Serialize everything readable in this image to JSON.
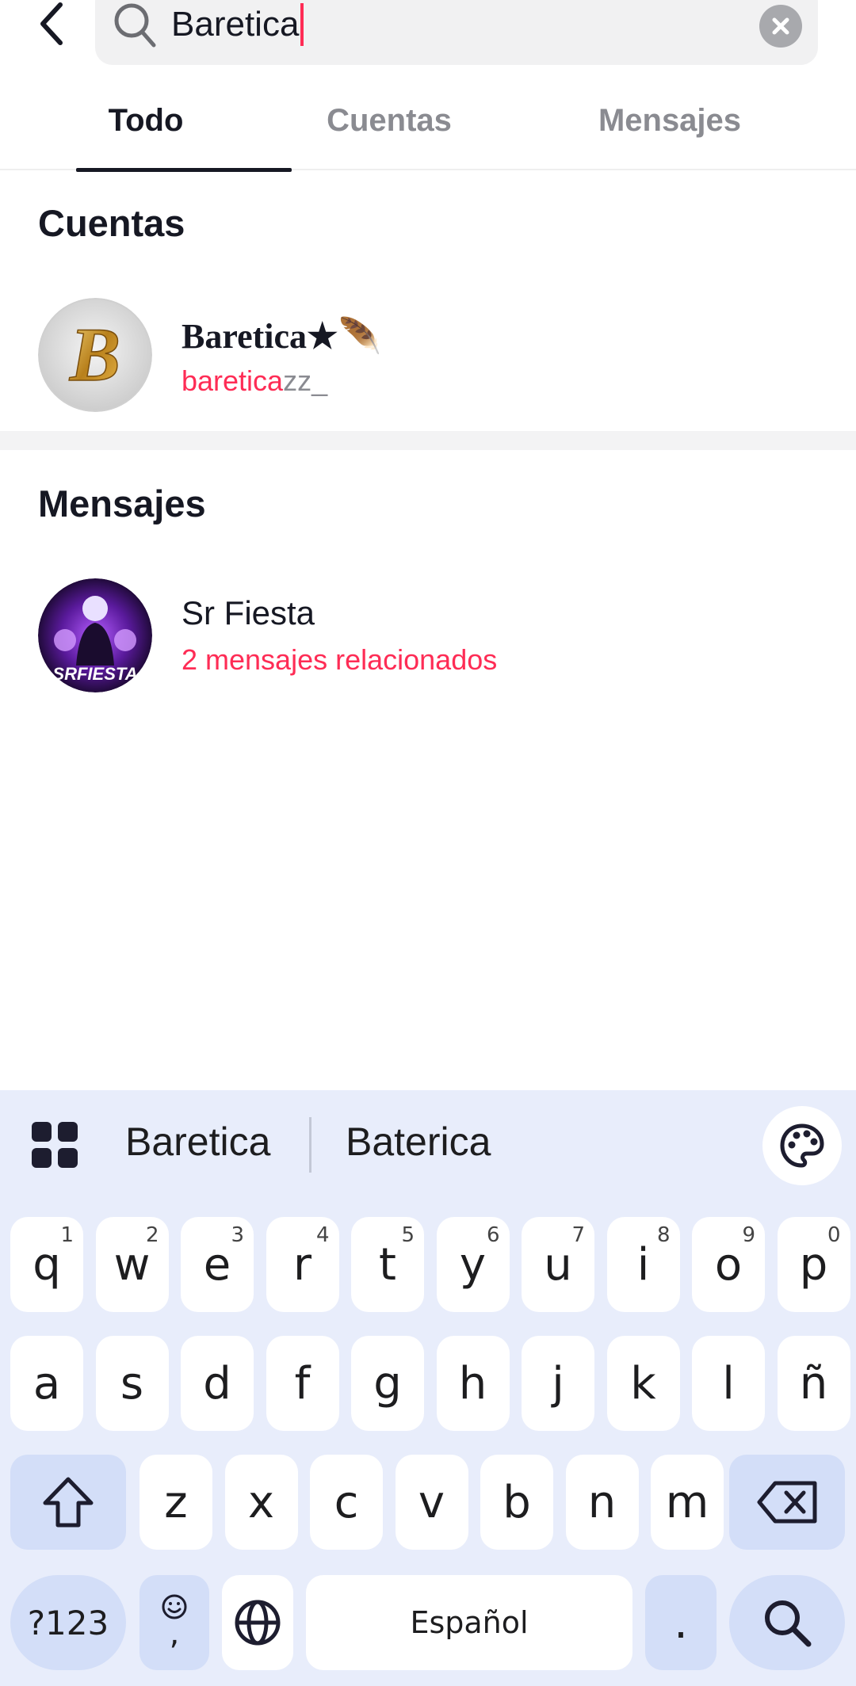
{
  "search": {
    "query": "Baretica"
  },
  "tabs": [
    {
      "label": "Todo",
      "active": true
    },
    {
      "label": "Cuentas",
      "active": false
    },
    {
      "label": "Mensajes",
      "active": false
    }
  ],
  "accounts_section": {
    "title": "Cuentas",
    "items": [
      {
        "display_name": "Baretica★🪶",
        "username_match": "baretica",
        "username_rest": "zz_"
      }
    ]
  },
  "messages_section": {
    "title": "Mensajes",
    "items": [
      {
        "name": "Sr Fiesta",
        "detail": "2 mensajes relacionados"
      }
    ]
  },
  "keyboard": {
    "suggestions": [
      "Baretica",
      "Baterica"
    ],
    "row1": [
      {
        "key": "q",
        "hint": "1"
      },
      {
        "key": "w",
        "hint": "2"
      },
      {
        "key": "e",
        "hint": "3"
      },
      {
        "key": "r",
        "hint": "4"
      },
      {
        "key": "t",
        "hint": "5"
      },
      {
        "key": "y",
        "hint": "6"
      },
      {
        "key": "u",
        "hint": "7"
      },
      {
        "key": "i",
        "hint": "8"
      },
      {
        "key": "o",
        "hint": "9"
      },
      {
        "key": "p",
        "hint": "0"
      }
    ],
    "row2": [
      "a",
      "s",
      "d",
      "f",
      "g",
      "h",
      "j",
      "k",
      "l",
      "ñ"
    ],
    "row3": [
      "z",
      "x",
      "c",
      "v",
      "b",
      "n",
      "m"
    ],
    "symbols_label": "?123",
    "comma_label": ",",
    "space_label": "Español",
    "period_label": "."
  },
  "colors": {
    "accent": "#fe2c55",
    "keyboard_bg": "#e8edfb",
    "function_key": "#d3def8"
  }
}
